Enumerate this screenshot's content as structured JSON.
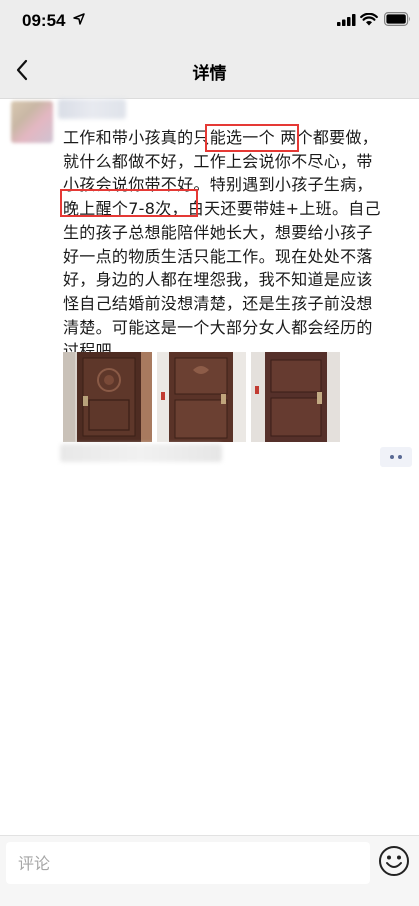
{
  "status_bar": {
    "time": "09:54"
  },
  "nav": {
    "title": "详情"
  },
  "post": {
    "author_name": "",
    "text": "工作和带小孩真的只能选一个  两个都要做，\n就什么都做不好，工作上会说你不尽心，带\n小孩会说你带不好。特别遇到小孩子生病，\n晚上醒个7-8次，白天还要带娃+上班。自己\n生的孩子总想能陪伴她长大，想要给小孩子\n好一点的物质生活只能工作。现在处处不落\n好，身边的人都在埋怨我，我不知道是应该\n怪自己结婚前没想清楚，还是生孩子前没想\n清楚。可能这是一个大部分女人都会经历的\n过程吧。",
    "highlights": [
      "只能选一个",
      "晚上醒个7-8次，"
    ],
    "photos": [
      {
        "icon": "door-photo-icon"
      },
      {
        "icon": "door-photo-icon"
      },
      {
        "icon": "door-photo-icon"
      }
    ]
  },
  "comment": {
    "placeholder": "评论"
  },
  "colors": {
    "highlight": "#e53935",
    "header_bg": "#ededed",
    "door": "#5a3428",
    "wall": "#e9e5e0"
  }
}
